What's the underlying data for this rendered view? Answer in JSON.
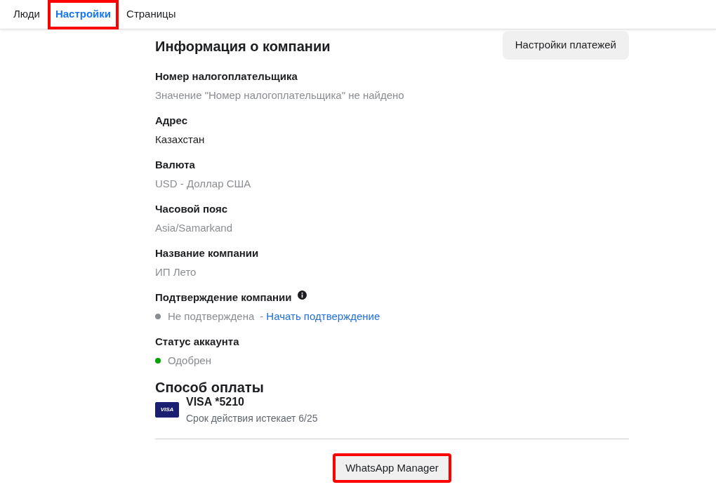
{
  "tabs": [
    {
      "label": "Люди",
      "selected": false,
      "highlighted": false
    },
    {
      "label": "Настройки",
      "selected": true,
      "highlighted": true
    },
    {
      "label": "Страницы",
      "selected": false,
      "highlighted": false
    }
  ],
  "section": {
    "title": "Информация о компании",
    "button": "Настройки платежей"
  },
  "fields": [
    {
      "label": "Номер налогоплательщика",
      "value": "Значение \"Номер налогоплательщика\" не найдено",
      "muted": true
    },
    {
      "label": "Адрес",
      "value": "Казахстан",
      "muted": false
    },
    {
      "label": "Валюта",
      "value": "USD - Доллар США",
      "muted": true
    },
    {
      "label": "Часовой пояс",
      "value": "Asia/Samarkand",
      "muted": true
    },
    {
      "label": "Название компании",
      "value": "ИП Лето",
      "muted": true
    }
  ],
  "verification": {
    "label": "Подтверждение компании",
    "status": "Не подтверждена",
    "color": "#8a8d91",
    "separator": "-",
    "link": "Начать подтверждение"
  },
  "account_status": {
    "label": "Статус аккаунта",
    "status": "Одобрен",
    "color": "#00a400"
  },
  "payment": {
    "title": "Способ оплаты",
    "card_brand": "VISA",
    "card": "VISA *5210",
    "expiry": "Срок действия истекает 6/25"
  },
  "footer_button": {
    "label": "WhatsApp Manager",
    "highlighted": true
  }
}
